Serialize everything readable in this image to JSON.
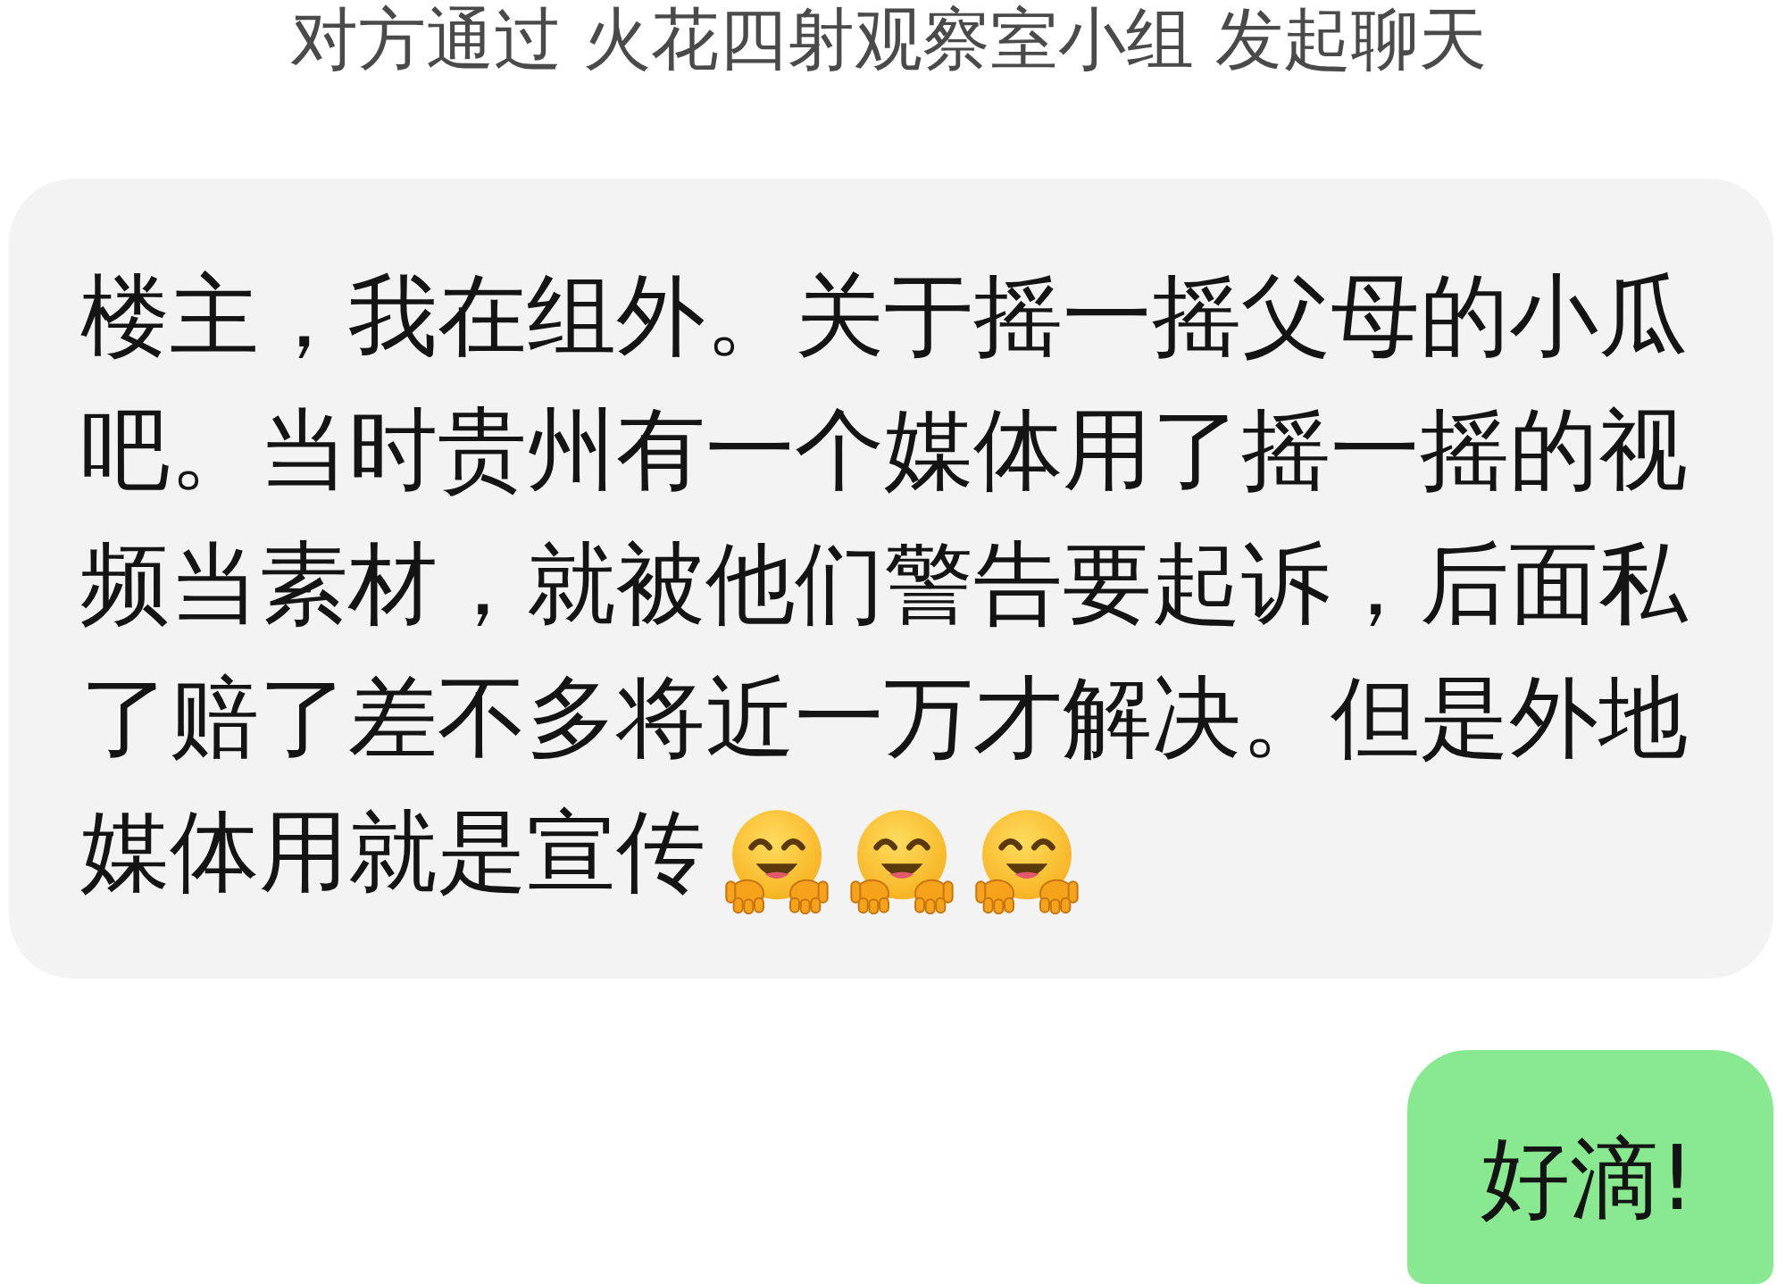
{
  "header": {
    "text": "对方通过 火花四射观察室小组 发起聊天"
  },
  "messages": [
    {
      "kind": "incoming",
      "lines": [
        "楼主，我在组外。关于摇一摇父母的小瓜",
        "吧。当时贵州有一个媒体用了摇一摇的视",
        "频当素材，就被他们警告要起诉，后面私",
        "了赔了差不多将近一万才解决。但是外地",
        "媒体用就是宣传"
      ],
      "icons": [
        {
          "kind": "hugging-face"
        },
        {
          "kind": "hugging-face"
        },
        {
          "kind": "hugging-face"
        }
      ]
    },
    {
      "kind": "outgoing",
      "lines": [
        "好滴!"
      ]
    }
  ]
}
